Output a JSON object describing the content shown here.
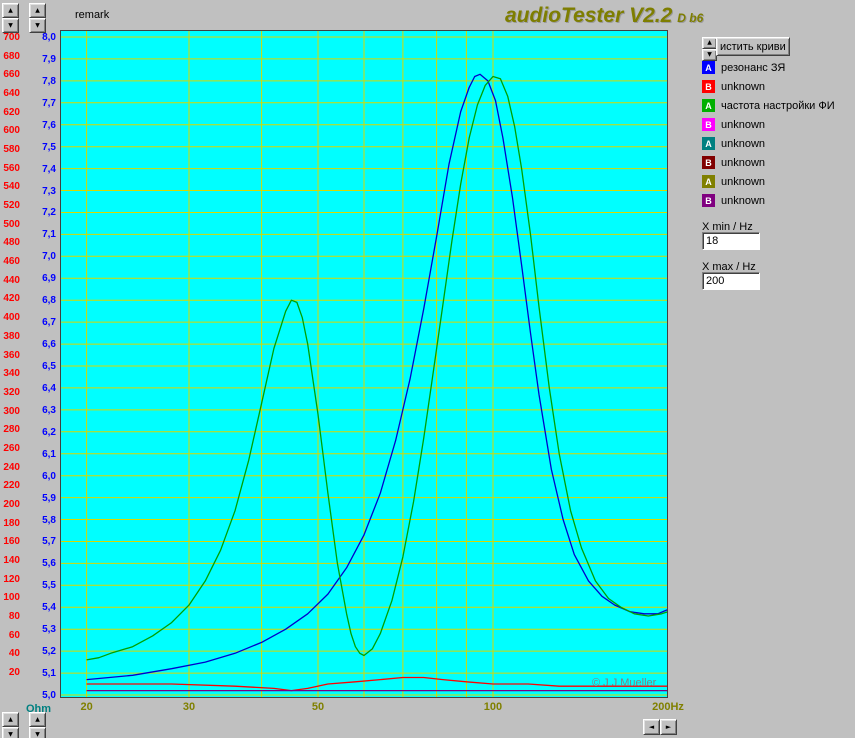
{
  "window": {
    "remark": "remark",
    "title": "audioTester V2.2",
    "title_suffix": "D b6",
    "copyright": "© J.J.Mueller"
  },
  "axes": {
    "ohm_label": "Ohm",
    "red_ticks": [
      "700",
      "680",
      "660",
      "640",
      "620",
      "600",
      "580",
      "560",
      "540",
      "520",
      "500",
      "480",
      "460",
      "440",
      "420",
      "400",
      "380",
      "360",
      "340",
      "320",
      "300",
      "280",
      "260",
      "240",
      "220",
      "200",
      "180",
      "160",
      "140",
      "120",
      "100",
      "80",
      "60",
      "40",
      "20"
    ],
    "blue_ticks": [
      "8,0",
      "7,9",
      "7,8",
      "7,7",
      "7,6",
      "7,5",
      "7,4",
      "7,3",
      "7,2",
      "7,1",
      "7,0",
      "6,9",
      "6,8",
      "6,7",
      "6,6",
      "6,5",
      "6,4",
      "6,3",
      "6,2",
      "6,1",
      "6,0",
      "5,9",
      "5,8",
      "5,7",
      "5,6",
      "5,5",
      "5,4",
      "5,3",
      "5,2",
      "5,1",
      "5,0"
    ],
    "freq_labels": [
      {
        "f": 20,
        "label": "20"
      },
      {
        "f": 30,
        "label": "30"
      },
      {
        "f": 50,
        "label": "50"
      },
      {
        "f": 100,
        "label": "100"
      },
      {
        "f": 200,
        "label": "200Hz"
      }
    ]
  },
  "panel": {
    "clear_button": "истить криви",
    "legend": [
      {
        "letter": "A",
        "color": "#0000ff",
        "label": "резонанс ЗЯ"
      },
      {
        "letter": "B",
        "color": "#ff0000",
        "label": "unknown"
      },
      {
        "letter": "A",
        "color": "#00b000",
        "label": "частота настройки ФИ"
      },
      {
        "letter": "B",
        "color": "#ff00ff",
        "label": "unknown"
      },
      {
        "letter": "A",
        "color": "#008080",
        "label": "unknown"
      },
      {
        "letter": "B",
        "color": "#800000",
        "label": "unknown"
      },
      {
        "letter": "A",
        "color": "#808000",
        "label": "unknown"
      },
      {
        "letter": "B",
        "color": "#800080",
        "label": "unknown"
      }
    ],
    "xmin_label": "X min / Hz",
    "xmin_value": "18",
    "xmax_label": "X max / Hz",
    "xmax_value": "200"
  },
  "chart_data": {
    "type": "line",
    "background": "#00ffff",
    "grid_color": "#d8d800",
    "x_axis": {
      "scale": "log",
      "min": 18,
      "max": 200,
      "unit": "Hz",
      "gridlines": [
        20,
        30,
        40,
        50,
        60,
        70,
        80,
        90,
        100,
        200
      ]
    },
    "y_axis_left_inner": {
      "min": 5.0,
      "max": 8.0,
      "step": 0.1,
      "color": "#0000ff"
    },
    "y_axis_left_outer": {
      "min": 20,
      "max": 700,
      "step": 20,
      "unit": "Ohm",
      "color": "#ff0000"
    },
    "series": [
      {
        "id": "closed-box",
        "name": "резонанс ЗЯ",
        "color": "#0000cd",
        "points": [
          [
            20,
            5.07
          ],
          [
            24,
            5.09
          ],
          [
            28,
            5.12
          ],
          [
            32,
            5.15
          ],
          [
            36,
            5.19
          ],
          [
            40,
            5.24
          ],
          [
            44,
            5.3
          ],
          [
            48,
            5.37
          ],
          [
            52,
            5.46
          ],
          [
            56,
            5.58
          ],
          [
            60,
            5.73
          ],
          [
            64,
            5.92
          ],
          [
            68,
            6.16
          ],
          [
            72,
            6.44
          ],
          [
            76,
            6.76
          ],
          [
            80,
            7.09
          ],
          [
            84,
            7.42
          ],
          [
            88,
            7.66
          ],
          [
            91,
            7.77
          ],
          [
            93,
            7.82
          ],
          [
            95,
            7.83
          ],
          [
            98,
            7.8
          ],
          [
            101,
            7.71
          ],
          [
            104,
            7.54
          ],
          [
            108,
            7.27
          ],
          [
            112,
            6.96
          ],
          [
            116,
            6.65
          ],
          [
            120,
            6.37
          ],
          [
            126,
            6.03
          ],
          [
            132,
            5.8
          ],
          [
            138,
            5.64
          ],
          [
            146,
            5.52
          ],
          [
            154,
            5.45
          ],
          [
            162,
            5.41
          ],
          [
            172,
            5.38
          ],
          [
            182,
            5.37
          ],
          [
            192,
            5.37
          ],
          [
            200,
            5.39
          ]
        ]
      },
      {
        "id": "vented-box",
        "name": "частота настройки ФИ",
        "color": "#00a000",
        "points": [
          [
            20,
            5.16
          ],
          [
            21,
            5.17
          ],
          [
            22,
            5.19
          ],
          [
            24,
            5.22
          ],
          [
            26,
            5.27
          ],
          [
            28,
            5.33
          ],
          [
            30,
            5.41
          ],
          [
            32,
            5.52
          ],
          [
            34,
            5.66
          ],
          [
            36,
            5.84
          ],
          [
            38,
            6.07
          ],
          [
            40,
            6.33
          ],
          [
            42,
            6.58
          ],
          [
            44,
            6.75
          ],
          [
            45,
            6.8
          ],
          [
            46,
            6.79
          ],
          [
            47,
            6.72
          ],
          [
            48,
            6.6
          ],
          [
            50,
            6.28
          ],
          [
            52,
            5.92
          ],
          [
            54,
            5.6
          ],
          [
            56,
            5.37
          ],
          [
            57,
            5.28
          ],
          [
            58,
            5.22
          ],
          [
            59,
            5.19
          ],
          [
            60,
            5.18
          ],
          [
            62,
            5.21
          ],
          [
            64,
            5.28
          ],
          [
            67,
            5.43
          ],
          [
            70,
            5.63
          ],
          [
            73,
            5.88
          ],
          [
            76,
            6.17
          ],
          [
            79,
            6.48
          ],
          [
            82,
            6.78
          ],
          [
            85,
            7.07
          ],
          [
            88,
            7.33
          ],
          [
            91,
            7.54
          ],
          [
            94,
            7.69
          ],
          [
            97,
            7.78
          ],
          [
            100,
            7.82
          ],
          [
            103,
            7.81
          ],
          [
            106,
            7.73
          ],
          [
            109,
            7.59
          ],
          [
            112,
            7.4
          ],
          [
            116,
            7.1
          ],
          [
            120,
            6.77
          ],
          [
            125,
            6.4
          ],
          [
            130,
            6.1
          ],
          [
            136,
            5.84
          ],
          [
            142,
            5.67
          ],
          [
            150,
            5.52
          ],
          [
            158,
            5.44
          ],
          [
            166,
            5.4
          ],
          [
            175,
            5.37
          ],
          [
            185,
            5.36
          ],
          [
            195,
            5.37
          ],
          [
            200,
            5.38
          ]
        ]
      },
      {
        "id": "flat-red",
        "name": "unknown",
        "color": "#ff0000",
        "points": [
          [
            20,
            5.05
          ],
          [
            28,
            5.05
          ],
          [
            36,
            5.04
          ],
          [
            42,
            5.03
          ],
          [
            45,
            5.02
          ],
          [
            48,
            5.03
          ],
          [
            52,
            5.05
          ],
          [
            58,
            5.06
          ],
          [
            64,
            5.07
          ],
          [
            70,
            5.08
          ],
          [
            76,
            5.08
          ],
          [
            82,
            5.07
          ],
          [
            90,
            5.06
          ],
          [
            100,
            5.05
          ],
          [
            115,
            5.05
          ],
          [
            130,
            5.04
          ],
          [
            150,
            5.04
          ],
          [
            175,
            5.04
          ],
          [
            200,
            5.04
          ]
        ]
      },
      {
        "id": "flat-dark",
        "name": "unknown",
        "color": "#800080",
        "points": [
          [
            20,
            5.02
          ],
          [
            40,
            5.02
          ],
          [
            60,
            5.02
          ],
          [
            80,
            5.02
          ],
          [
            100,
            5.02
          ],
          [
            130,
            5.02
          ],
          [
            160,
            5.02
          ],
          [
            200,
            5.02
          ]
        ]
      }
    ]
  }
}
